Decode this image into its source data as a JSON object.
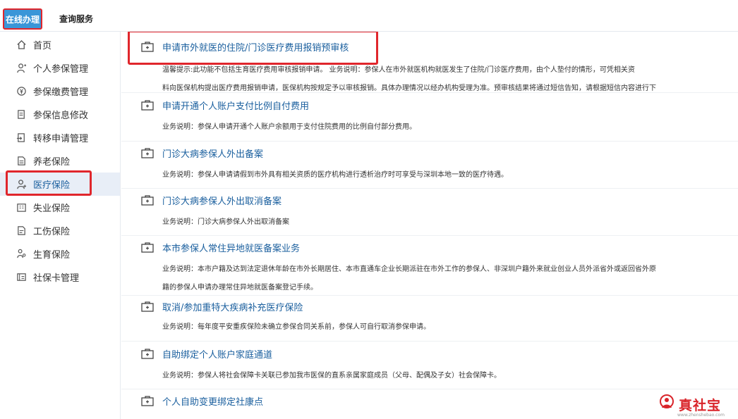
{
  "topbar": {
    "tabs": [
      "在线办理",
      "查询服务"
    ]
  },
  "sidebar": {
    "items": [
      {
        "label": "首页",
        "icon": "home-icon"
      },
      {
        "label": "个人参保管理",
        "icon": "person-icon"
      },
      {
        "label": "参保缴费管理",
        "icon": "payment-icon"
      },
      {
        "label": "参保信息修改",
        "icon": "document-edit-icon"
      },
      {
        "label": "转移申请管理",
        "icon": "transfer-icon"
      },
      {
        "label": "养老保险",
        "icon": "document-icon"
      },
      {
        "label": "医疗保险",
        "icon": "medical-person-icon",
        "active": true
      },
      {
        "label": "失业保险",
        "icon": "building-icon"
      },
      {
        "label": "工伤保险",
        "icon": "document-icon"
      },
      {
        "label": "生育保险",
        "icon": "family-icon"
      },
      {
        "label": "社保卡管理",
        "icon": "card-icon"
      }
    ]
  },
  "services": [
    {
      "title": "申请市外就医的住院/门诊医疗费用报销预审核",
      "desc": [
        "温馨提示:此功能不包括生育医疗费用审核报销申请。 业务说明：参保人在市外就医机构就医发生了住院/门诊医疗费用，由个人垫付的情形，可凭相关资",
        "料向医保机构提出医疗费用报销申请，医保机构按规定予以审核报销。具体办理情况以经办机构受理为准。预审核结果将通过短信告知，请根据短信内容进行下"
      ]
    },
    {
      "title": "申请开通个人账户支付比例自付费用",
      "desc": [
        "业务说明：参保人申请开通个人账户余额用于支付住院费用的比例自付部分费用。"
      ]
    },
    {
      "title": "门诊大病参保人外出备案",
      "desc": [
        "业务说明：参保人申请请假到市外具有相关资质的医疗机构进行透析治疗时可享受与深圳本地一致的医疗待遇。"
      ]
    },
    {
      "title": "门诊大病参保人外出取消备案",
      "desc": [
        "业务说明：门诊大病参保人外出取消备案"
      ]
    },
    {
      "title": "本市参保人常住异地就医备案业务",
      "desc": [
        "业务说明：本市户籍及达到法定退休年龄在市外长期居住、本市直通车企业长期派驻在市外工作的参保人、非深圳户籍外来就业创业人员外派省外或返回省外原",
        "籍的参保人申请办理常住异地就医备案登记手续。"
      ]
    },
    {
      "title": "取消/参加重特大疾病补充医疗保险",
      "desc": [
        "业务说明：每年度平安重疾保险未确立参保合同关系前，参保人可自行取消参保申请。"
      ]
    },
    {
      "title": "自助绑定个人账户家庭通道",
      "desc": [
        "业务说明：参保人将社会保障卡关联已参加我市医保的直系亲属家庭成员（父母、配偶及子女）社会保障卡。"
      ]
    },
    {
      "title": "个人自助变更绑定社康点",
      "desc": []
    }
  ],
  "watermark": {
    "text": "真社宝",
    "sub": "www.zhenshebao.com"
  },
  "colors": {
    "accent": "#3a96d8",
    "highlight": "#e0262c",
    "link": "#1a5f9e"
  }
}
